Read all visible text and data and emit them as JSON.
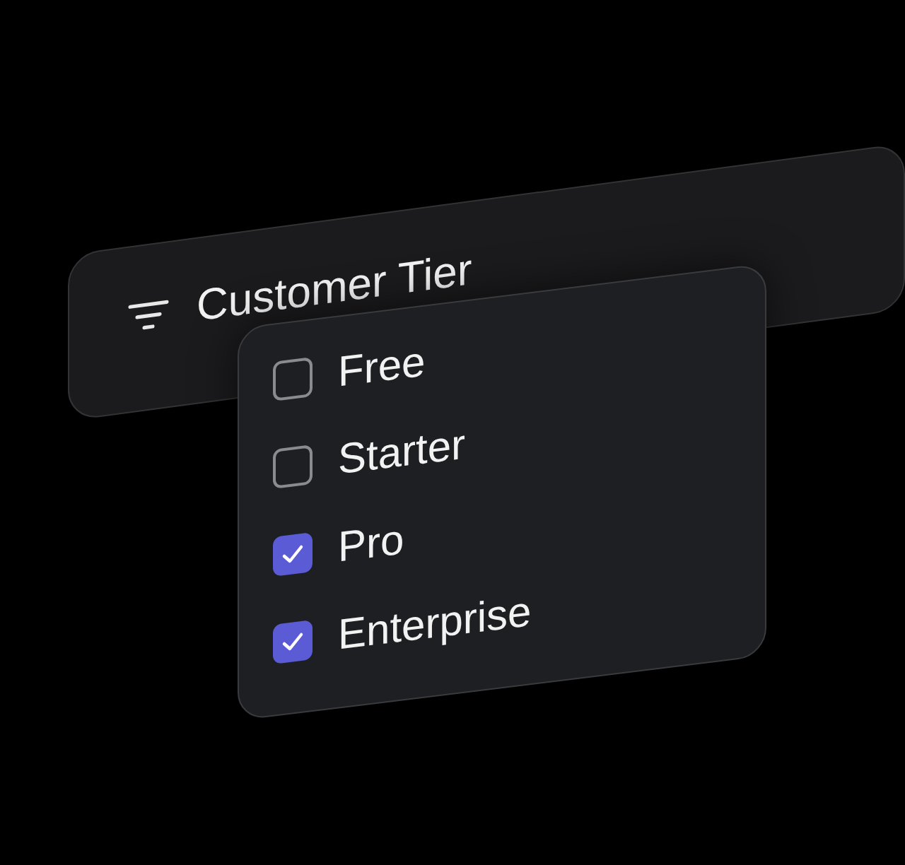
{
  "filter": {
    "label": "Customer Tier"
  },
  "options": [
    {
      "label": "Free",
      "checked": false
    },
    {
      "label": "Starter",
      "checked": false
    },
    {
      "label": "Pro",
      "checked": true
    },
    {
      "label": "Enterprise",
      "checked": true
    }
  ]
}
